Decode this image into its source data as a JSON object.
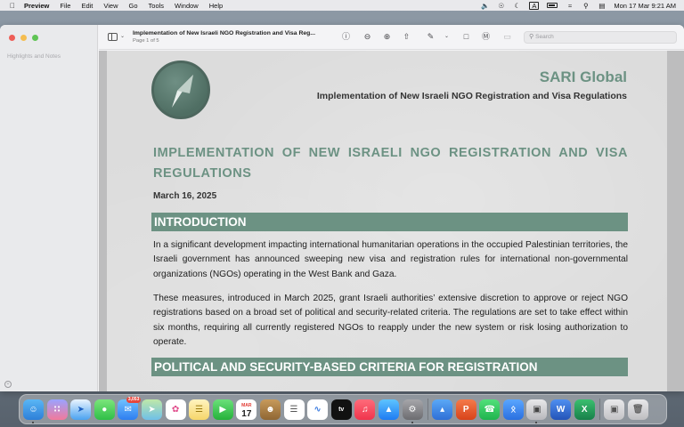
{
  "menubar": {
    "app_name": "Preview",
    "menus": [
      "File",
      "Edit",
      "View",
      "Go",
      "Tools",
      "Window",
      "Help"
    ],
    "clock": "Mon 17 Mar  9:21 AM",
    "input_source": "A"
  },
  "sidebar": {
    "title": "Highlights and Notes"
  },
  "toolbar": {
    "doc_title": "Implementation of New Israeli NGO Registration and Visa Reg...",
    "page_indicator": "Page 1 of 5",
    "search_placeholder": "Search"
  },
  "document": {
    "brand": "SARI Global",
    "header_subtitle": "Implementation of New Israeli NGO Registration and Visa Regulations",
    "heading": "IMPLEMENTATION OF NEW ISRAELI NGO REGISTRATION AND VISA REGULATIONS",
    "date": "March 16, 2025",
    "section1_title": "INTRODUCTION",
    "para1": "In a significant development impacting international humanitarian operations in the occupied Palestinian territories, the Israeli government has announced sweeping new visa and registration rules for international non-governmental organizations (NGOs) operating in the West Bank and Gaza.",
    "para2": "These measures, introduced in March 2025, grant Israeli authorities’ extensive discretion to approve or reject NGO registrations based on a broad set of political and security-related criteria. The regulations are set to take effect within six months, requiring all currently registered NGOs to reapply under the new system or risk losing authorization to operate.",
    "section2_title": "POLITICAL AND SECURITY-BASED CRITERIA FOR REGISTRATION"
  },
  "dock": {
    "mail_badge": "3,053",
    "calendar_month": "MAR",
    "calendar_day": "17",
    "tv_label": "tv"
  },
  "colors": {
    "accent_green": "#6c9283",
    "window_bg": "#f2f2f4"
  }
}
